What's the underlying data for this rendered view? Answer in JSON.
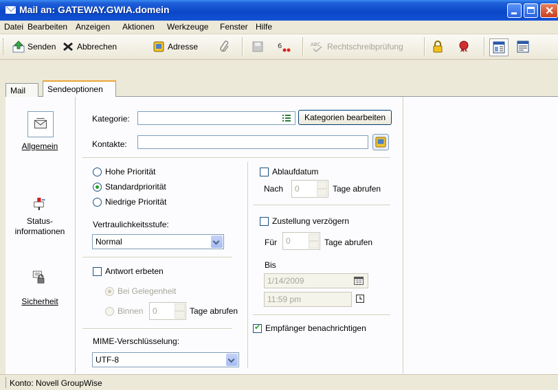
{
  "window": {
    "title": "Mail an: GATEWAY.GWIA.domein"
  },
  "menu": [
    "Datei",
    "Bearbeiten",
    "Anzeigen",
    "Aktionen",
    "Werkzeuge",
    "Fenster",
    "Hilfe"
  ],
  "toolbar": {
    "send": "Senden",
    "cancel": "Abbrechen",
    "address": "Adresse",
    "spellcheck": "Rechtschreibprüfung"
  },
  "tabs": {
    "mail": "Mail",
    "send_options": "Sendeoptionen"
  },
  "sidebar": {
    "general": "Allgemein",
    "status_line1": "Status-",
    "status_line2": "informationen",
    "security": "Sicherheit"
  },
  "form": {
    "category_label": "Kategorie:",
    "category_value": "",
    "edit_categories": "Kategorien bearbeiten",
    "contacts_label": "Kontakte:",
    "contacts_value": "",
    "priority_high": "Hohe Priorität",
    "priority_standard": "Standardpriorität",
    "priority_low": "Niedrige Priorität",
    "priority_selected": "standard",
    "confidentiality_label": "Vertraulichkeitsstufe:",
    "confidentiality_value": "Normal",
    "reply_requested": "Antwort erbeten",
    "reply_requested_checked": false,
    "when_convenient": "Bei Gelegenheit",
    "within": "Binnen",
    "within_value": "0",
    "days_label": "Tage abrufen",
    "mime_label": "MIME-Verschlüsselung:",
    "mime_value": "UTF-8",
    "expiration": "Ablaufdatum",
    "expiration_checked": false,
    "after": "Nach",
    "after_value": "0",
    "days_after_label": "Tage abrufen",
    "delay_delivery": "Zustellung verzögern",
    "delay_delivery_checked": false,
    "for": "Für",
    "for_value": "0",
    "days_for_label": "Tage abrufen",
    "until": "Bis",
    "until_date": "1/14/2009",
    "until_time": "11:59 pm",
    "notify_recipients": "Empfänger benachrichtigen",
    "notify_recipients_checked": true
  },
  "status": {
    "account": "Konto: Novell GroupWise"
  },
  "colors": {
    "title_bar": "#0a46c8",
    "tab_highlight": "#e8a33a",
    "check_mark": "#21a121"
  }
}
